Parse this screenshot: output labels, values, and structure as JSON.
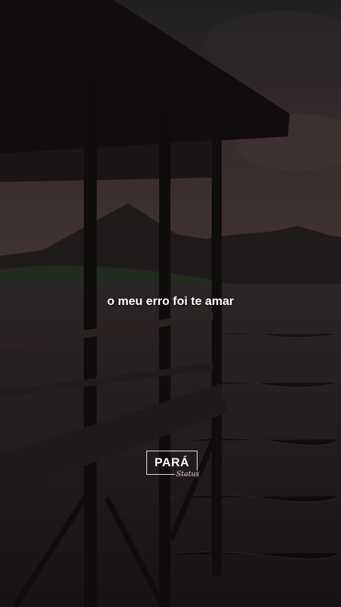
{
  "caption": "o meu erro foi te amar",
  "logo": {
    "title": "PARÁ",
    "subtitle": "Status"
  },
  "colors": {
    "sky": "#4a3a3c",
    "water": "#2a2426",
    "caption_text": "#ffffff",
    "logo_border": "#f3e6ea"
  }
}
